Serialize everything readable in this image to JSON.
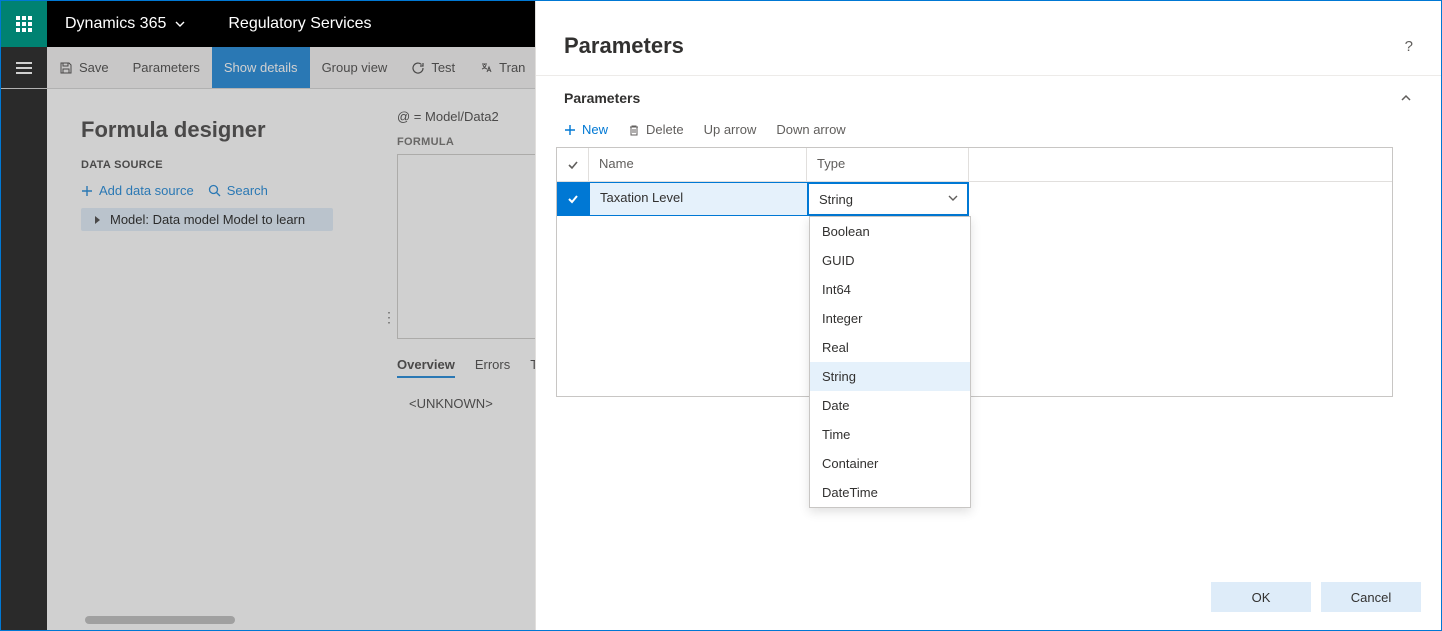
{
  "header": {
    "brand": "Dynamics 365",
    "module": "Regulatory Services"
  },
  "actions": {
    "save": "Save",
    "parameters": "Parameters",
    "show_details": "Show details",
    "group_view": "Group view",
    "test": "Test",
    "translate": "Tran"
  },
  "main": {
    "title": "Formula designer",
    "ds_label": "DATA SOURCE",
    "add_ds": "Add data source",
    "search": "Search",
    "model_node": "Model: Data model Model to learn",
    "at_line": "@ = Model/Data2",
    "formula_label": "FORMULA",
    "tabs": {
      "overview": "Overview",
      "errors": "Errors",
      "test": "Tes"
    },
    "output": "<UNKNOWN>"
  },
  "panel": {
    "title": "Parameters",
    "section": "Parameters",
    "toolbar": {
      "new": "New",
      "delete": "Delete",
      "up": "Up arrow",
      "down": "Down arrow"
    },
    "grid": {
      "headers": {
        "name": "Name",
        "type": "Type"
      },
      "row": {
        "name": "Taxation Level",
        "type": "String"
      }
    },
    "type_options": [
      "Boolean",
      "GUID",
      "Int64",
      "Integer",
      "Real",
      "String",
      "Date",
      "Time",
      "Container",
      "DateTime"
    ],
    "selected_type": "String",
    "ok": "OK",
    "cancel": "Cancel"
  }
}
